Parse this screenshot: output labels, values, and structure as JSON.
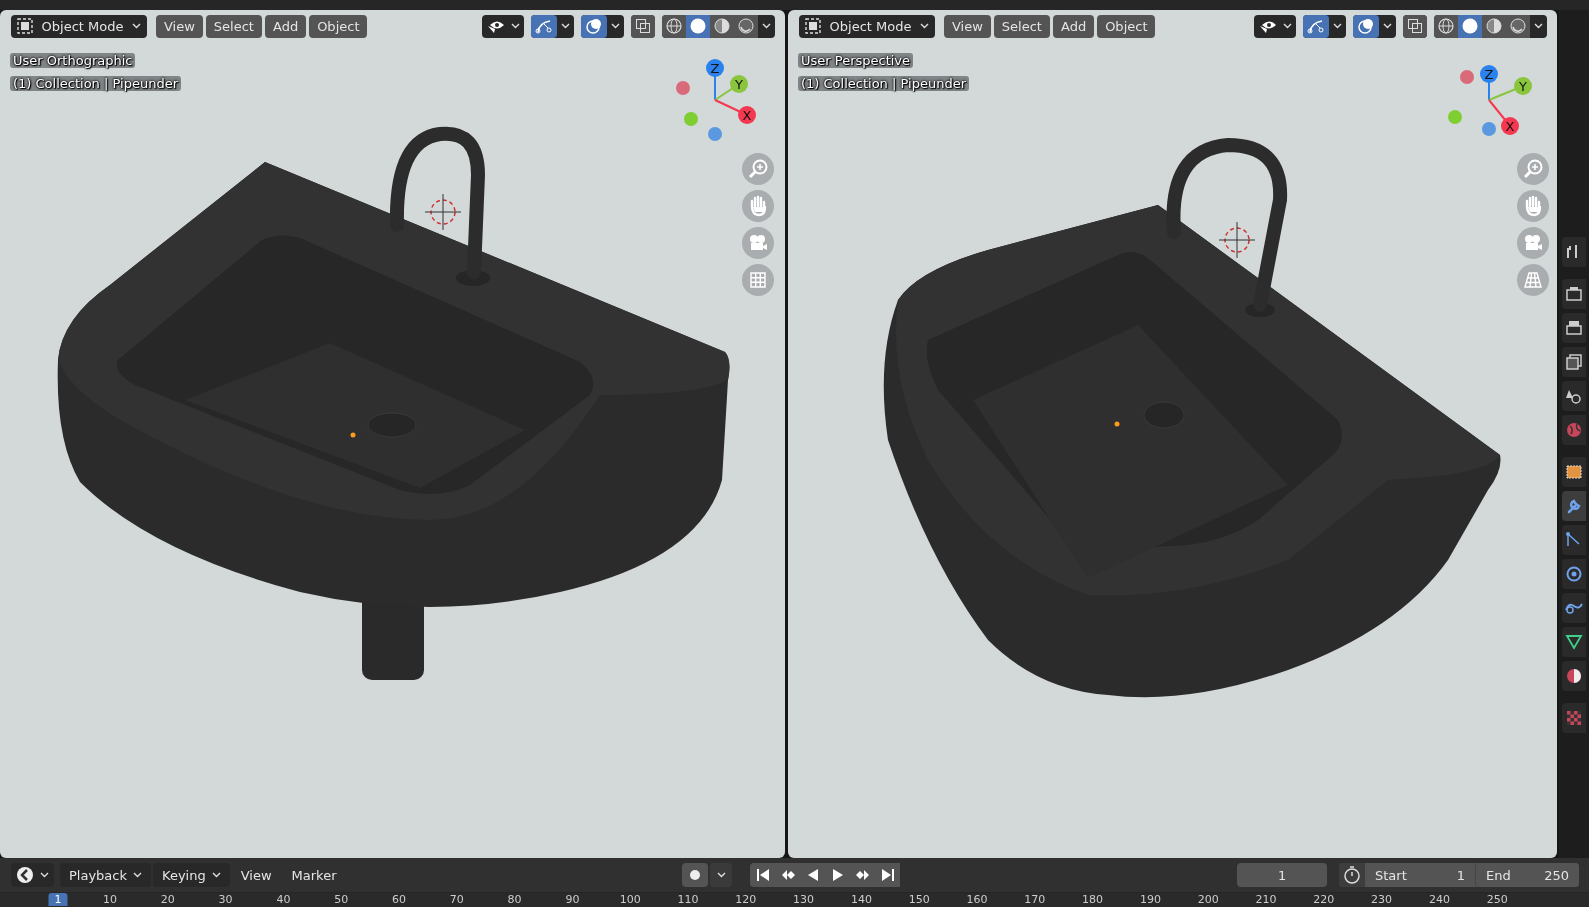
{
  "viewports": [
    {
      "kind": "orthographic",
      "mode": "Object Mode",
      "menus": [
        "View",
        "Select",
        "Add",
        "Object"
      ],
      "gizmos_on": true,
      "overlays_on": true,
      "xray": false,
      "shading": [
        {
          "kind": "wireframe",
          "selected": false
        },
        {
          "kind": "solid",
          "selected": true
        },
        {
          "kind": "material",
          "selected": false
        },
        {
          "kind": "rendered",
          "selected": false
        }
      ],
      "view_name": "User Orthographic",
      "collection": "(1) Collection | Pipeunder",
      "axes": [
        "Z",
        "Y",
        "X"
      ]
    },
    {
      "kind": "perspective",
      "mode": "Object Mode",
      "menus": [
        "View",
        "Select",
        "Add",
        "Object"
      ],
      "gizmos_on": true,
      "overlays_on": true,
      "xray": false,
      "shading": [
        {
          "kind": "wireframe",
          "selected": false
        },
        {
          "kind": "solid",
          "selected": true
        },
        {
          "kind": "material",
          "selected": false
        },
        {
          "kind": "rendered",
          "selected": false
        }
      ],
      "view_name": "User Perspective",
      "collection": "(1) Collection | Pipeunder",
      "axes": [
        "Z",
        "Y",
        "X"
      ]
    }
  ],
  "timeline": {
    "menus": [
      {
        "label": "Playback",
        "dropdown": true
      },
      {
        "label": "Keying",
        "dropdown": true
      },
      {
        "label": "View",
        "dropdown": false
      },
      {
        "label": "Marker",
        "dropdown": false
      }
    ],
    "auto_keying": false,
    "current_frame": "1",
    "start_label": "Start",
    "start": "1",
    "end_label": "End",
    "end": "250",
    "ruler": [
      {
        "label": "1",
        "selected": true
      },
      {
        "label": "10",
        "selected": false
      },
      {
        "label": "20",
        "selected": false
      },
      {
        "label": "30",
        "selected": false
      },
      {
        "label": "40",
        "selected": false
      },
      {
        "label": "50",
        "selected": false
      },
      {
        "label": "60",
        "selected": false
      },
      {
        "label": "70",
        "selected": false
      },
      {
        "label": "80",
        "selected": false
      },
      {
        "label": "90",
        "selected": false
      },
      {
        "label": "100",
        "selected": false
      },
      {
        "label": "110",
        "selected": false
      },
      {
        "label": "120",
        "selected": false
      },
      {
        "label": "130",
        "selected": false
      },
      {
        "label": "140",
        "selected": false
      },
      {
        "label": "150",
        "selected": false
      },
      {
        "label": "160",
        "selected": false
      },
      {
        "label": "170",
        "selected": false
      },
      {
        "label": "180",
        "selected": false
      },
      {
        "label": "190",
        "selected": false
      },
      {
        "label": "200",
        "selected": false
      },
      {
        "label": "210",
        "selected": false
      },
      {
        "label": "220",
        "selected": false
      },
      {
        "label": "230",
        "selected": false
      },
      {
        "label": "240",
        "selected": false
      },
      {
        "label": "250",
        "selected": false
      }
    ]
  },
  "properties_tabs": [
    {
      "kind": "tool",
      "selected": false
    },
    {
      "kind": "render",
      "selected": false
    },
    {
      "kind": "output",
      "selected": false
    },
    {
      "kind": "view_layer",
      "selected": false
    },
    {
      "kind": "scene",
      "selected": false
    },
    {
      "kind": "world",
      "selected": false
    },
    {
      "kind": "object",
      "selected": false
    },
    {
      "kind": "modifier",
      "selected": true
    },
    {
      "kind": "particles",
      "selected": false
    },
    {
      "kind": "physics",
      "selected": false
    },
    {
      "kind": "constraints",
      "selected": false
    },
    {
      "kind": "data",
      "selected": false
    },
    {
      "kind": "material",
      "selected": false
    },
    {
      "kind": "texture",
      "selected": false
    }
  ]
}
